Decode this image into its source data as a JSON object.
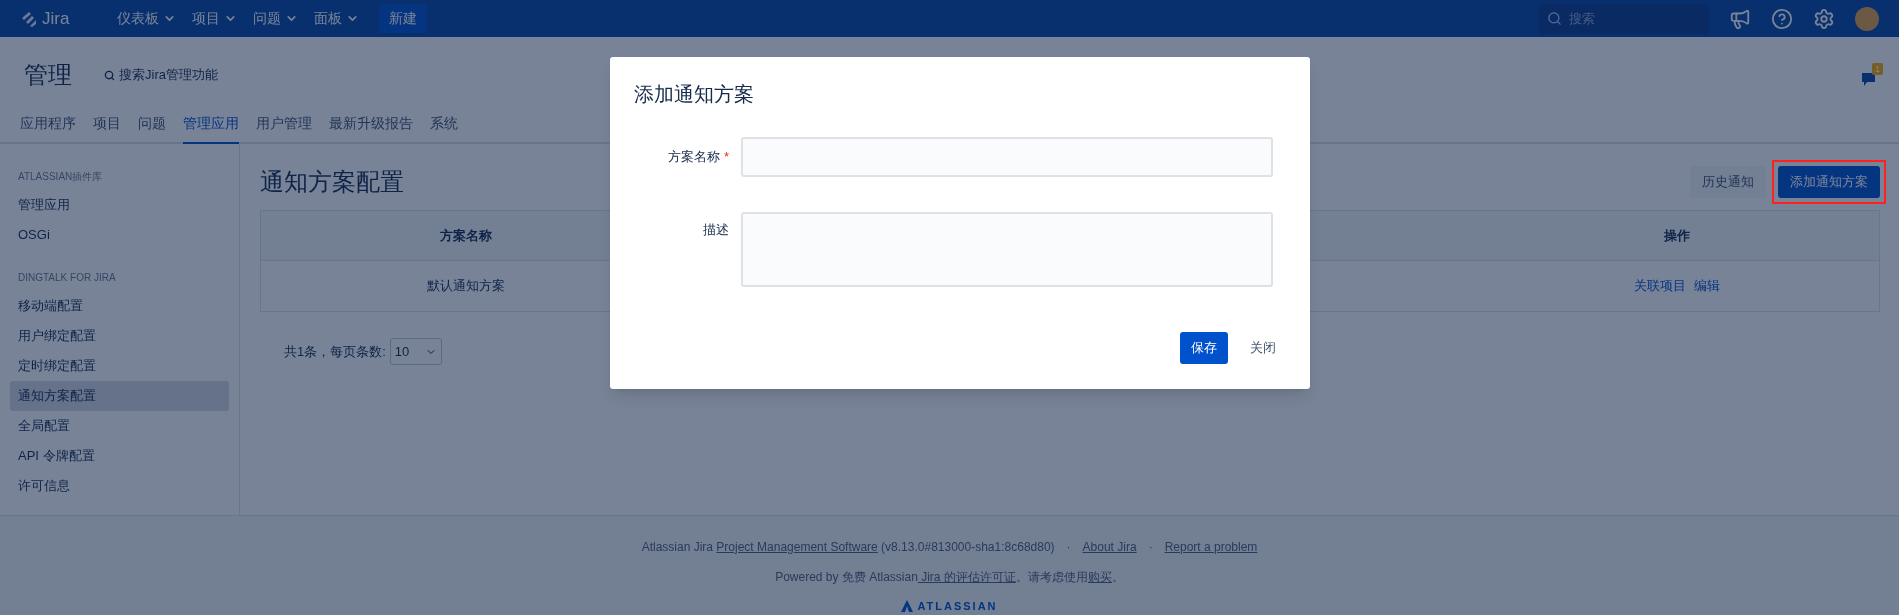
{
  "top_nav": {
    "logo": "Jira",
    "menus": [
      {
        "label": "仪表板"
      },
      {
        "label": "项目"
      },
      {
        "label": "问题"
      },
      {
        "label": "面板"
      }
    ],
    "create_button": "新建",
    "search": {
      "placeholder": "搜索"
    }
  },
  "header": {
    "title": "管理",
    "search_link": "搜索Jira管理功能",
    "notification_count": "1"
  },
  "tabs": [
    {
      "label": "应用程序",
      "selected": false
    },
    {
      "label": "项目",
      "selected": false
    },
    {
      "label": "问题",
      "selected": false
    },
    {
      "label": "管理应用",
      "selected": true
    },
    {
      "label": "用户管理",
      "selected": false
    },
    {
      "label": "最新升级报告",
      "selected": false
    },
    {
      "label": "系统",
      "selected": false
    }
  ],
  "sidebar": {
    "sections": [
      {
        "heading": "ATLASSIAN插件库",
        "items": [
          {
            "label": "管理应用",
            "selected": false
          },
          {
            "label": "OSGi",
            "selected": false
          }
        ]
      },
      {
        "heading": "DINGTALK FOR JIRA",
        "items": [
          {
            "label": "移动端配置",
            "selected": false
          },
          {
            "label": "用户绑定配置",
            "selected": false
          },
          {
            "label": "定时绑定配置",
            "selected": false
          },
          {
            "label": "通知方案配置",
            "selected": true
          },
          {
            "label": "全局配置",
            "selected": false
          },
          {
            "label": "API 令牌配置",
            "selected": false
          },
          {
            "label": "许可信息",
            "selected": false
          }
        ]
      }
    ]
  },
  "page": {
    "title": "通知方案配置",
    "buttons": [
      {
        "label": "历史通知",
        "kind": "secondary",
        "highlighted": false
      },
      {
        "label": "添加通知方案",
        "kind": "primary",
        "highlighted": true
      }
    ],
    "table": {
      "columns": [
        "方案名称",
        "操作"
      ],
      "rows": [
        {
          "name": "默认通知方案",
          "actions": [
            "关联项目",
            "编辑"
          ]
        }
      ]
    },
    "pagination": {
      "summary": "共1条，每页条数:",
      "page_size": "10"
    }
  },
  "footer": {
    "lines": [
      [
        {
          "kind": "text",
          "text": "Atlassian Jira "
        },
        {
          "kind": "link",
          "text": "Project Management Software"
        },
        {
          "kind": "text",
          "text": " (v8.13.0#813000-sha1:8c68d80)"
        },
        {
          "kind": "dot",
          "text": "·"
        },
        {
          "kind": "link",
          "text": "About Jira"
        },
        {
          "kind": "dot",
          "text": "·"
        },
        {
          "kind": "link",
          "text": "Report a problem"
        }
      ],
      [
        {
          "kind": "text",
          "text": "Powered by 免费 Atlassian"
        },
        {
          "kind": "link",
          "text": " Jira 的评估许可证"
        },
        {
          "kind": "text",
          "text": "。请考虑使用"
        },
        {
          "kind": "link",
          "text": "购买"
        },
        {
          "kind": "text",
          "text": "。"
        }
      ]
    ],
    "logo": "ATLASSIAN"
  },
  "dialog": {
    "title": "添加通知方案",
    "fields": [
      {
        "label": "方案名称",
        "required_mark": "*",
        "kind": "input"
      },
      {
        "label": "描述",
        "kind": "textarea"
      }
    ],
    "buttons": [
      {
        "label": "保存",
        "kind": "primary"
      },
      {
        "label": "关闭",
        "kind": "link"
      }
    ]
  }
}
